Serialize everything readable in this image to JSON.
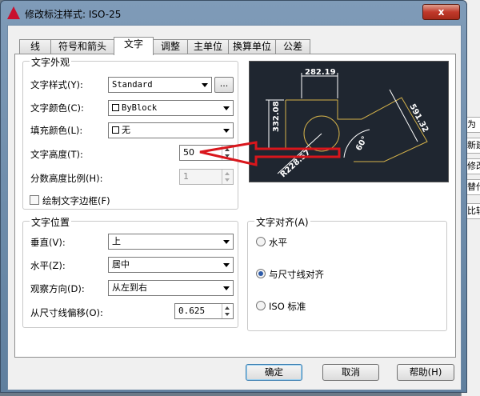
{
  "window": {
    "title": "修改标注样式: ISO-25",
    "close_label": "x"
  },
  "background_strip": [
    "为",
    "新建",
    "修改",
    "替代",
    "比较"
  ],
  "tabs": [
    {
      "label": "线",
      "active": false
    },
    {
      "label": "符号和箭头",
      "active": false
    },
    {
      "label": "文字",
      "active": true
    },
    {
      "label": "调整",
      "active": false
    },
    {
      "label": "主单位",
      "active": false
    },
    {
      "label": "换算单位",
      "active": false
    },
    {
      "label": "公差",
      "active": false
    }
  ],
  "appearance": {
    "title": "文字外观",
    "style_label": "文字样式(Y):",
    "style_value": "Standard",
    "style_browse": "...",
    "color_label": "文字颜色(C):",
    "color_value": "ByBlock",
    "fill_label": "填充颜色(L):",
    "fill_value": "无",
    "height_label": "文字高度(T):",
    "height_value": "50",
    "fraction_label": "分数高度比例(H):",
    "fraction_value": "1",
    "frame_label": "绘制文字边框(F)",
    "frame_checked": false
  },
  "placement": {
    "title": "文字位置",
    "vertical_label": "垂直(V):",
    "vertical_value": "上",
    "horizontal_label": "水平(Z):",
    "horizontal_value": "居中",
    "view_label": "观察方向(D):",
    "view_value": "从左到右",
    "offset_label": "从尺寸线偏移(O):",
    "offset_value": "0.625"
  },
  "alignment": {
    "title": "文字对齐(A)",
    "options": [
      {
        "label": "水平",
        "selected": false
      },
      {
        "label": "与尺寸线对齐",
        "selected": true
      },
      {
        "label": "ISO 标准",
        "selected": false
      }
    ]
  },
  "preview": {
    "dim_top": "282.19",
    "dim_left": "332.08",
    "dim_right": "591.32",
    "dim_radius": "R228.57",
    "dim_angle": "60°"
  },
  "buttons": {
    "ok": "确定",
    "cancel": "取消",
    "help": "帮助(H)"
  },
  "colors": {
    "preview_bg": "#1f2630",
    "preview_lines": "#d4b24a",
    "annotation_red": "#d9161c"
  }
}
